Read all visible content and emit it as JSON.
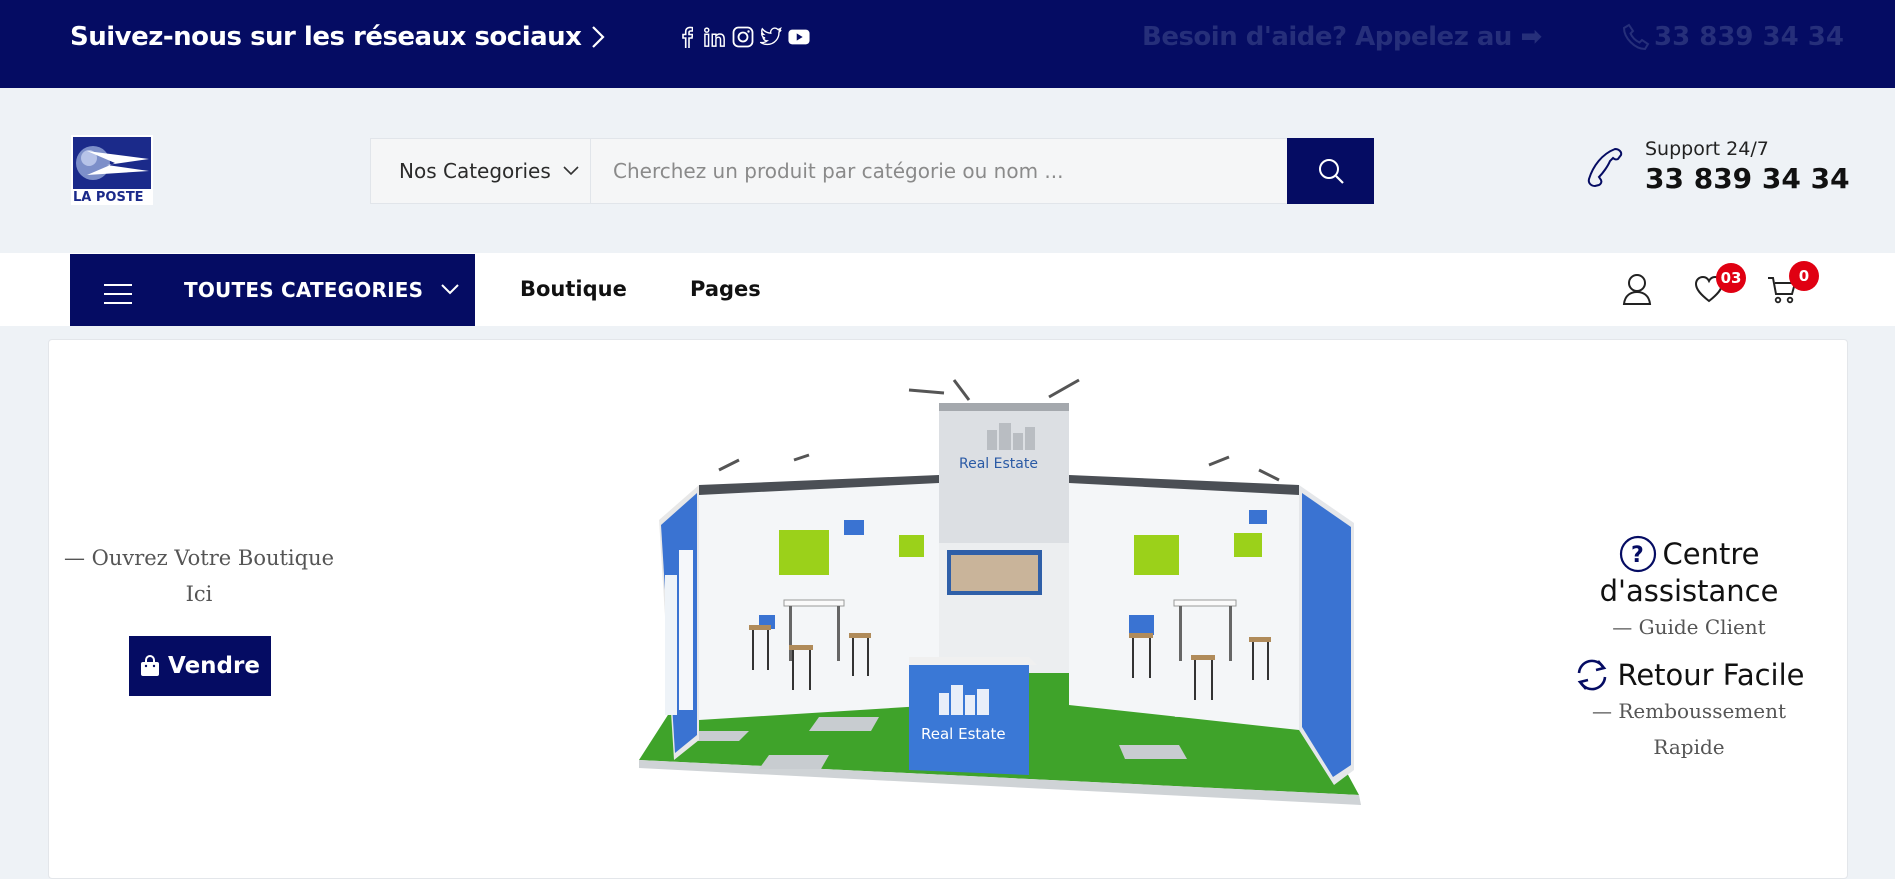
{
  "topbar": {
    "follow_text": "Suivez-nous sur les réseaux sociaux",
    "socials": [
      "facebook-icon",
      "linkedin-icon",
      "instagram-icon",
      "twitter-icon",
      "youtube-icon"
    ],
    "help_text": "Besoin d'aide? Appelez au ➡",
    "help_phone": "33 839 34 34"
  },
  "header": {
    "logo_text": "LA POSTE",
    "search": {
      "category_label": "Nos Categories",
      "placeholder": "Cherchez un produit par catégorie ou nom ..."
    },
    "support": {
      "label": "Support 24/7",
      "phone": "33 839 34 34"
    }
  },
  "nav": {
    "all_categories": "TOUTES CATEGORIES",
    "links": [
      "Boutique",
      "Pages"
    ],
    "wishlist_count": "03",
    "cart_count": "0"
  },
  "hero": {
    "open_shop_line1": "— Ouvrez Votre Boutique",
    "open_shop_line2": "Ici",
    "sell_button": "Vendre",
    "booth_brand": "Real Estate",
    "features": [
      {
        "title_line1": "Centre",
        "title_line2": "d'assistance",
        "subtitle_line1": "—  Guide Client",
        "subtitle_line2": ""
      },
      {
        "title_line1": "Retour Facile",
        "title_line2": "",
        "subtitle_line1": "—  Remboussement",
        "subtitle_line2": "Rapide"
      }
    ]
  },
  "colors": {
    "brand_navy": "#050c63",
    "badge_red": "#e00012",
    "page_bg": "#eef2f6"
  }
}
